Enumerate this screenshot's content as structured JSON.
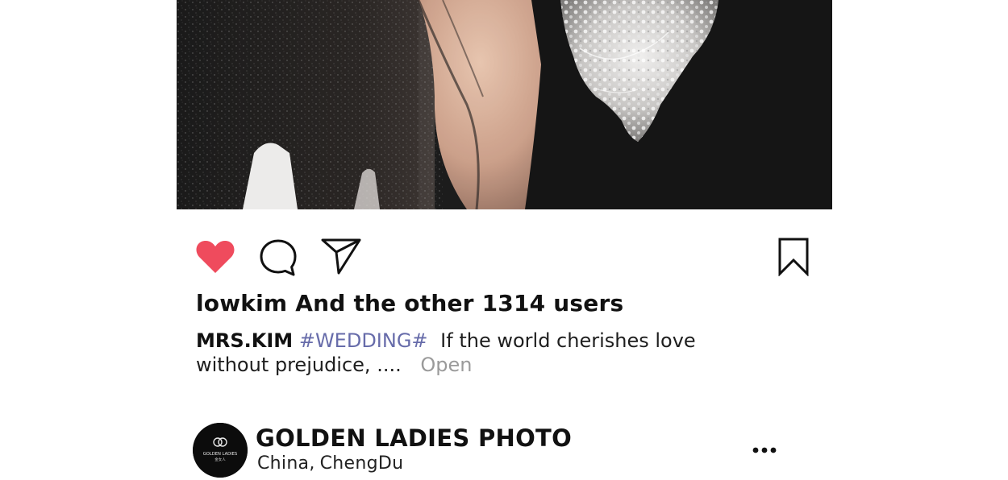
{
  "post": {
    "image": {
      "description_icon": "wedding-photo"
    },
    "actions": {
      "like_icon": "heart-icon",
      "like_color": "#ef4b5d",
      "comment_icon": "comment-icon",
      "share_icon": "send-icon",
      "bookmark_icon": "bookmark-icon"
    },
    "likes_text": "lowkim And the other 1314 users",
    "caption": {
      "author": "MRS.KIM",
      "hashtag": "#WEDDING#",
      "text": "If the world cherishes love without prejudice, ....",
      "more_label": "Open",
      "hashtag_color": "#676caa"
    }
  },
  "account": {
    "avatar_text": "GOLDEN LADIES",
    "avatar_subtext": "金女人",
    "name": "GOLDEN LADIES PHOTO",
    "location_country": "China,",
    "location_city": "ChengDu",
    "more_icon": "more-icon"
  }
}
